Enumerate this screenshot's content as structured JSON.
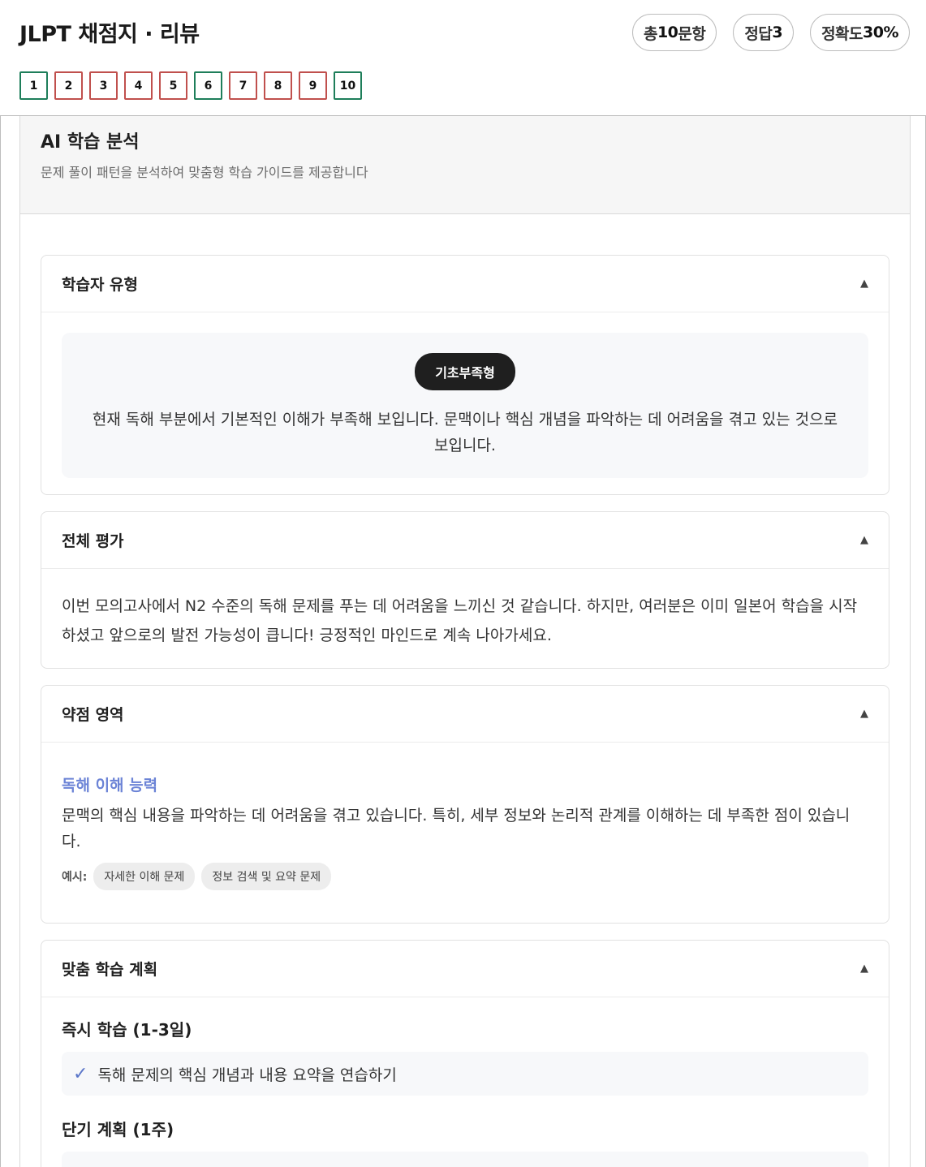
{
  "header": {
    "title": "JLPT 채점지 · 리뷰",
    "stats": [
      {
        "label": "총",
        "value": "10",
        "suffix": "문항"
      },
      {
        "label": "정답",
        "value": "3",
        "suffix": ""
      },
      {
        "label": "정확도",
        "value": "30%",
        "suffix": ""
      }
    ],
    "questions": [
      {
        "label": "1",
        "status": "correct"
      },
      {
        "label": "2",
        "status": "wrong"
      },
      {
        "label": "3",
        "status": "wrong"
      },
      {
        "label": "4",
        "status": "wrong"
      },
      {
        "label": "5",
        "status": "wrong"
      },
      {
        "label": "6",
        "status": "correct"
      },
      {
        "label": "7",
        "status": "wrong"
      },
      {
        "label": "8",
        "status": "wrong"
      },
      {
        "label": "9",
        "status": "wrong"
      },
      {
        "label": "10",
        "status": "correct"
      }
    ]
  },
  "analysis": {
    "title": "AI 학습 분석",
    "subtitle": "문제 풀이 패턴을 분석하여 맞춤형 학습 가이드를 제공합니다",
    "toggle_icon": "▲",
    "learner_type": {
      "title": "학습자 유형",
      "badge": "기초부족형",
      "description": "현재 독해 부분에서 기본적인 이해가 부족해 보입니다. 문맥이나 핵심 개념을 파악하는 데 어려움을 겪고 있는 것으로 보입니다."
    },
    "overall": {
      "title": "전체 평가",
      "text": "이번 모의고사에서 N2 수준의 독해 문제를 푸는 데 어려움을 느끼신 것 같습니다. 하지만, 여러분은 이미 일본어 학습을 시작하셨고 앞으로의 발전 가능성이 큽니다! 긍정적인 마인드로 계속 나아가세요."
    },
    "weakness": {
      "title": "약점 영역",
      "area_title": "독해 이해 능력",
      "area_desc": "문맥의 핵심 내용을 파악하는 데 어려움을 겪고 있습니다. 특히, 세부 정보와 논리적 관계를 이해하는 데 부족한 점이 있습니다.",
      "examples_label": "예시:",
      "examples": [
        "자세한 이해 문제",
        "정보 검색 및 요약 문제"
      ]
    },
    "plan": {
      "title": "맞춤 학습 계획",
      "immediate_title": "즉시 학습 (1-3일)",
      "immediate_items": [
        "독해 문제의 핵심 개념과 내용 요약을 연습하기"
      ],
      "short_title": "단기 계획 (1주)",
      "check_icon": "✓"
    }
  }
}
